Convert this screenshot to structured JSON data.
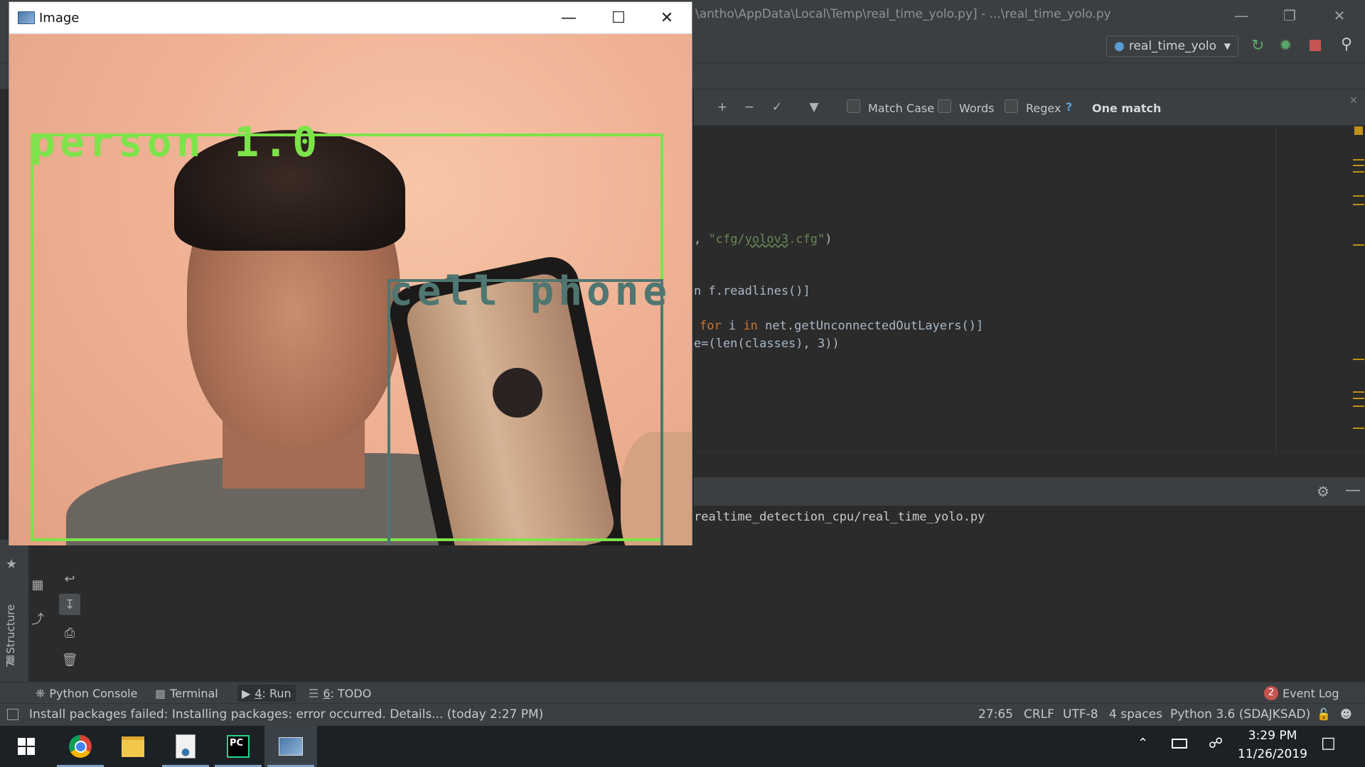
{
  "ide": {
    "title": "\\antho\\AppData\\Local\\Temp\\real_time_yolo.py] - ...\\real_time_yolo.py",
    "run_config": "real_time_yolo",
    "search": {
      "match_case": "Match Case",
      "words": "Words",
      "regex": "Regex",
      "help": "?",
      "result": "One match"
    },
    "code_lines": [
      {
        "pre": ", ",
        "str": "\"cfg/",
        "str_u": "yolov3",
        "str2": ".cfg\"",
        "post": ")"
      },
      {
        "pre": "n f.readlines()]"
      },
      {
        "kw1": "for",
        "mid1": " i ",
        "kw2": "in",
        "post": " net.getUnconnectedOutLayers()]"
      },
      {
        "pre": "e=(len(classes), 3))"
      }
    ],
    "console_path": "realtime_detection_cpu/real_time_yolo.py",
    "left_panel_label": "7: Structure",
    "tool_tabs": {
      "python_console": "Python Console",
      "terminal": "Terminal",
      "run_num": "4",
      "run": ": Run",
      "todo_num": "6",
      "todo": ": TODO",
      "event_log_count": "2",
      "event_log": "Event Log"
    },
    "status": {
      "message": "Install packages failed: Installing packages: error occurred. Details... (today 2:27 PM)",
      "position": "27:65",
      "line_sep": "CRLF",
      "encoding": "UTF-8",
      "indent": "4 spaces",
      "interpreter": "Python 3.6 (SDAJKSAD)"
    }
  },
  "image_window": {
    "title": "Image",
    "detections": [
      {
        "label": "person 1.0",
        "color": "#7de34a"
      },
      {
        "label": "cell phone",
        "color": "#4f7670"
      }
    ]
  },
  "taskbar": {
    "apps": [
      "windows-start",
      "chrome",
      "file-explorer",
      "python-idle",
      "pycharm",
      "image-viewer"
    ],
    "time": "3:29 PM",
    "date": "11/26/2019"
  },
  "colors": {
    "ide_bg": "#2b2b2b",
    "ide_panel": "#3c3f41",
    "keyword": "#cc7832",
    "string": "#6a8759",
    "marker": "#be9117",
    "taskbar": "#1c2126"
  }
}
